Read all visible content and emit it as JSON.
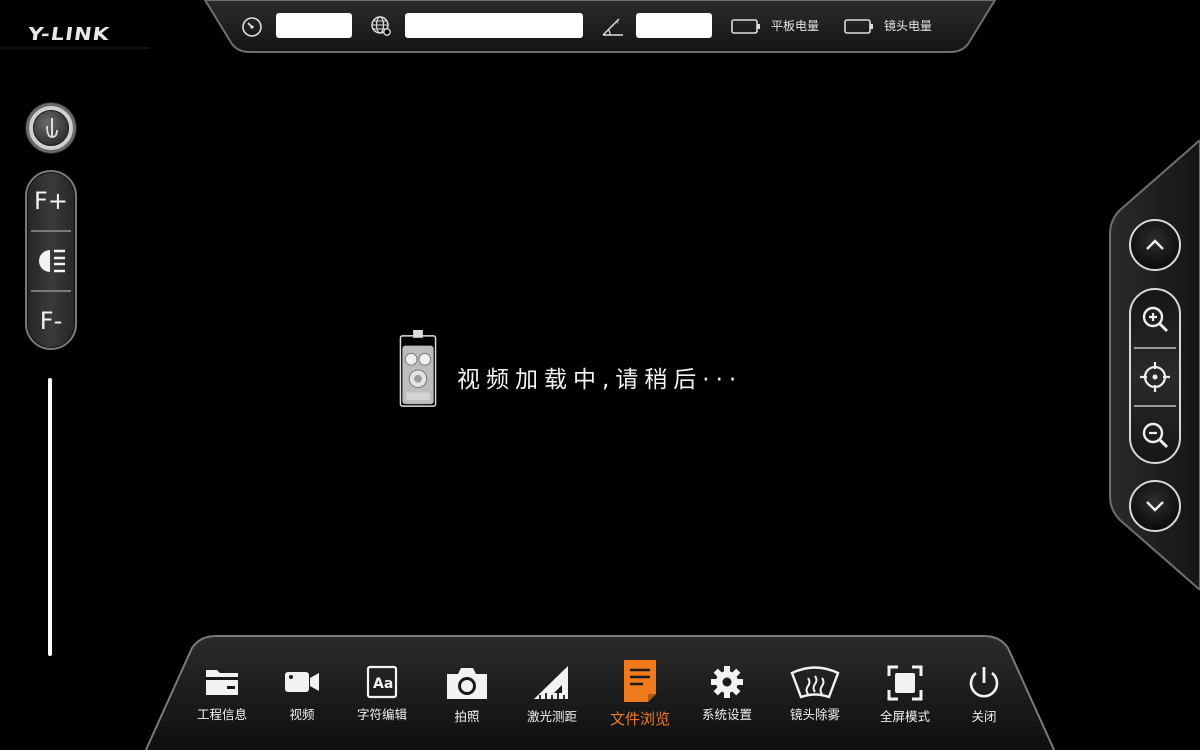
{
  "brand": {
    "logo_text": "Y-LINK"
  },
  "status_bar": {
    "speed_value": "",
    "location_value": "",
    "incline_value": "",
    "tablet_battery_label": "平板电量",
    "lens_battery_label": "镜头电量",
    "icons": [
      "gauge-icon",
      "globe-location-icon",
      "incline-angle-icon",
      "battery-icon",
      "battery-icon"
    ]
  },
  "left_controls": {
    "top_button_icon": "joystick-icon",
    "focus_plus_label": "F+",
    "light_icon": "headlight-icon",
    "focus_minus_label": "F-"
  },
  "right_controls": {
    "icons": [
      "chevron-up-icon",
      "zoom-in-icon",
      "crosshair-icon",
      "zoom-out-icon",
      "chevron-down-icon"
    ]
  },
  "loading": {
    "icon": "camera-robot-icon",
    "message": "视频加载中,请稍后···"
  },
  "toolbar": {
    "items": [
      {
        "label": "工程信息",
        "icon": "folder-icon",
        "active": false
      },
      {
        "label": "视频",
        "icon": "video-camera-icon",
        "active": false
      },
      {
        "label": "字符编辑",
        "icon": "text-aa-icon",
        "active": false
      },
      {
        "label": "拍照",
        "icon": "camera-icon",
        "active": false
      },
      {
        "label": "激光测距",
        "icon": "ruler-triangle-icon",
        "active": false
      },
      {
        "label": "文件浏览",
        "icon": "document-icon",
        "active": true
      },
      {
        "label": "系统设置",
        "icon": "gear-icon",
        "active": false
      },
      {
        "label": "镜头除雾",
        "icon": "defog-icon",
        "active": false
      },
      {
        "label": "全屏模式",
        "icon": "fullscreen-icon",
        "active": false
      },
      {
        "label": "关闭",
        "icon": "power-icon",
        "active": false
      }
    ],
    "active_color": "#f07a1c"
  },
  "colors": {
    "background": "#000000",
    "frame": "#3a3a3a",
    "accent": "#f07a1c"
  }
}
